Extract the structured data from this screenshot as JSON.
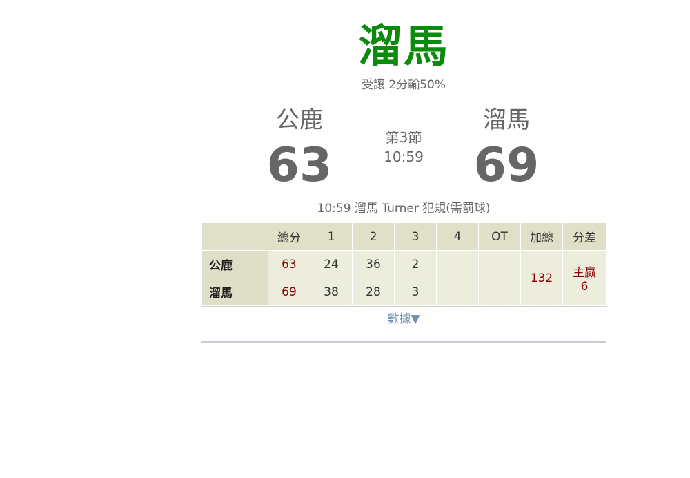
{
  "headline": {
    "team": "溜馬",
    "line": "受讓 2分輸50%"
  },
  "away": {
    "name": "公鹿",
    "score": "63"
  },
  "home": {
    "name": "溜馬",
    "score": "69"
  },
  "clock": {
    "period": "第3節",
    "time": "10:59"
  },
  "last_play": "10:59 溜馬 Turner 犯規(需罰球)",
  "table": {
    "headers": [
      "",
      "總分",
      "1",
      "2",
      "3",
      "4",
      "OT",
      "加總",
      "分差"
    ],
    "rows": [
      {
        "team": "公鹿",
        "total": "63",
        "q1": "24",
        "q2": "36",
        "q3": "2",
        "q4": "",
        "ot": ""
      },
      {
        "team": "溜馬",
        "total": "69",
        "q1": "38",
        "q2": "28",
        "q3": "3",
        "q4": "",
        "ot": ""
      }
    ],
    "sum": "132",
    "diff_label": "主贏",
    "diff_value": "6"
  },
  "data_link": "數據▼",
  "colors": {
    "headline": "#0b8a0b",
    "score_red": "#8b0000",
    "link": "#6d8fb5",
    "header_bg": "#e0e0c8",
    "cell_bg": "#ededdd"
  }
}
